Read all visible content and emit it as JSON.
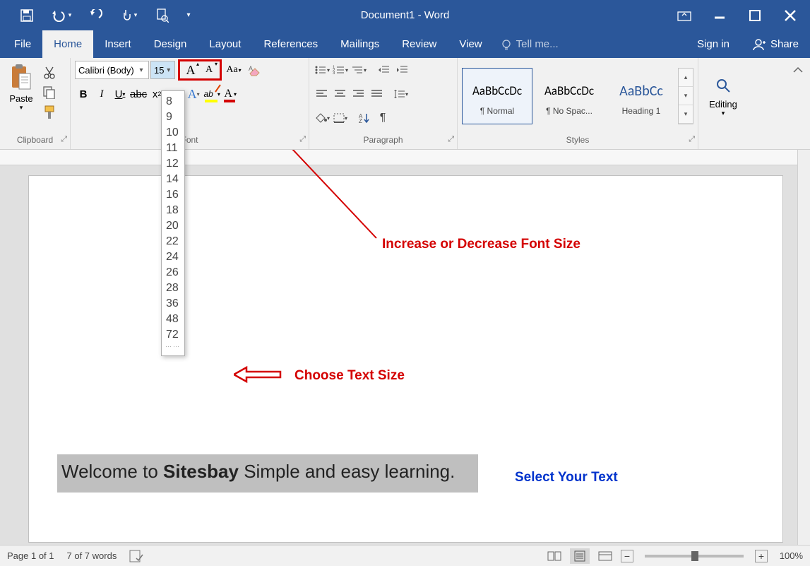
{
  "title": "Document1 - Word",
  "qat": {
    "save": "save",
    "undo": "undo",
    "redo": "redo",
    "touch": "touch",
    "preview": "preview"
  },
  "tabs": {
    "file": "File",
    "home": "Home",
    "insert": "Insert",
    "design": "Design",
    "layout": "Layout",
    "references": "References",
    "mailings": "Mailings",
    "review": "Review",
    "view": "View",
    "tell": "Tell me...",
    "signin": "Sign in",
    "share": "Share"
  },
  "clipboard": {
    "paste": "Paste",
    "label": "Clipboard"
  },
  "font": {
    "name": "Calibri (Body)",
    "size": "15",
    "sizes": [
      "8",
      "9",
      "10",
      "11",
      "12",
      "14",
      "16",
      "18",
      "20",
      "22",
      "24",
      "26",
      "28",
      "36",
      "48",
      "72"
    ]
  },
  "paragraph": {
    "label": "Paragraph"
  },
  "styles": {
    "label": "Styles",
    "items": [
      {
        "name": "¶ Normal",
        "preview": "AaBbCcDc"
      },
      {
        "name": "¶ No Spac...",
        "preview": "AaBbCcDc"
      },
      {
        "name": "Heading 1",
        "preview": "AaBbCc"
      }
    ]
  },
  "editing": {
    "label": "Editing"
  },
  "annotations": {
    "a1": "Increase or Decrease Font Size",
    "a2": "Choose Text Size",
    "a3": "Select Your Text"
  },
  "doc": {
    "pre": "Welcome to ",
    "bold": "Sitesbay",
    "post": " Simple and easy learning."
  },
  "status": {
    "page": "Page 1 of 1",
    "words": "7 of 7 words",
    "zoom": "100%"
  }
}
